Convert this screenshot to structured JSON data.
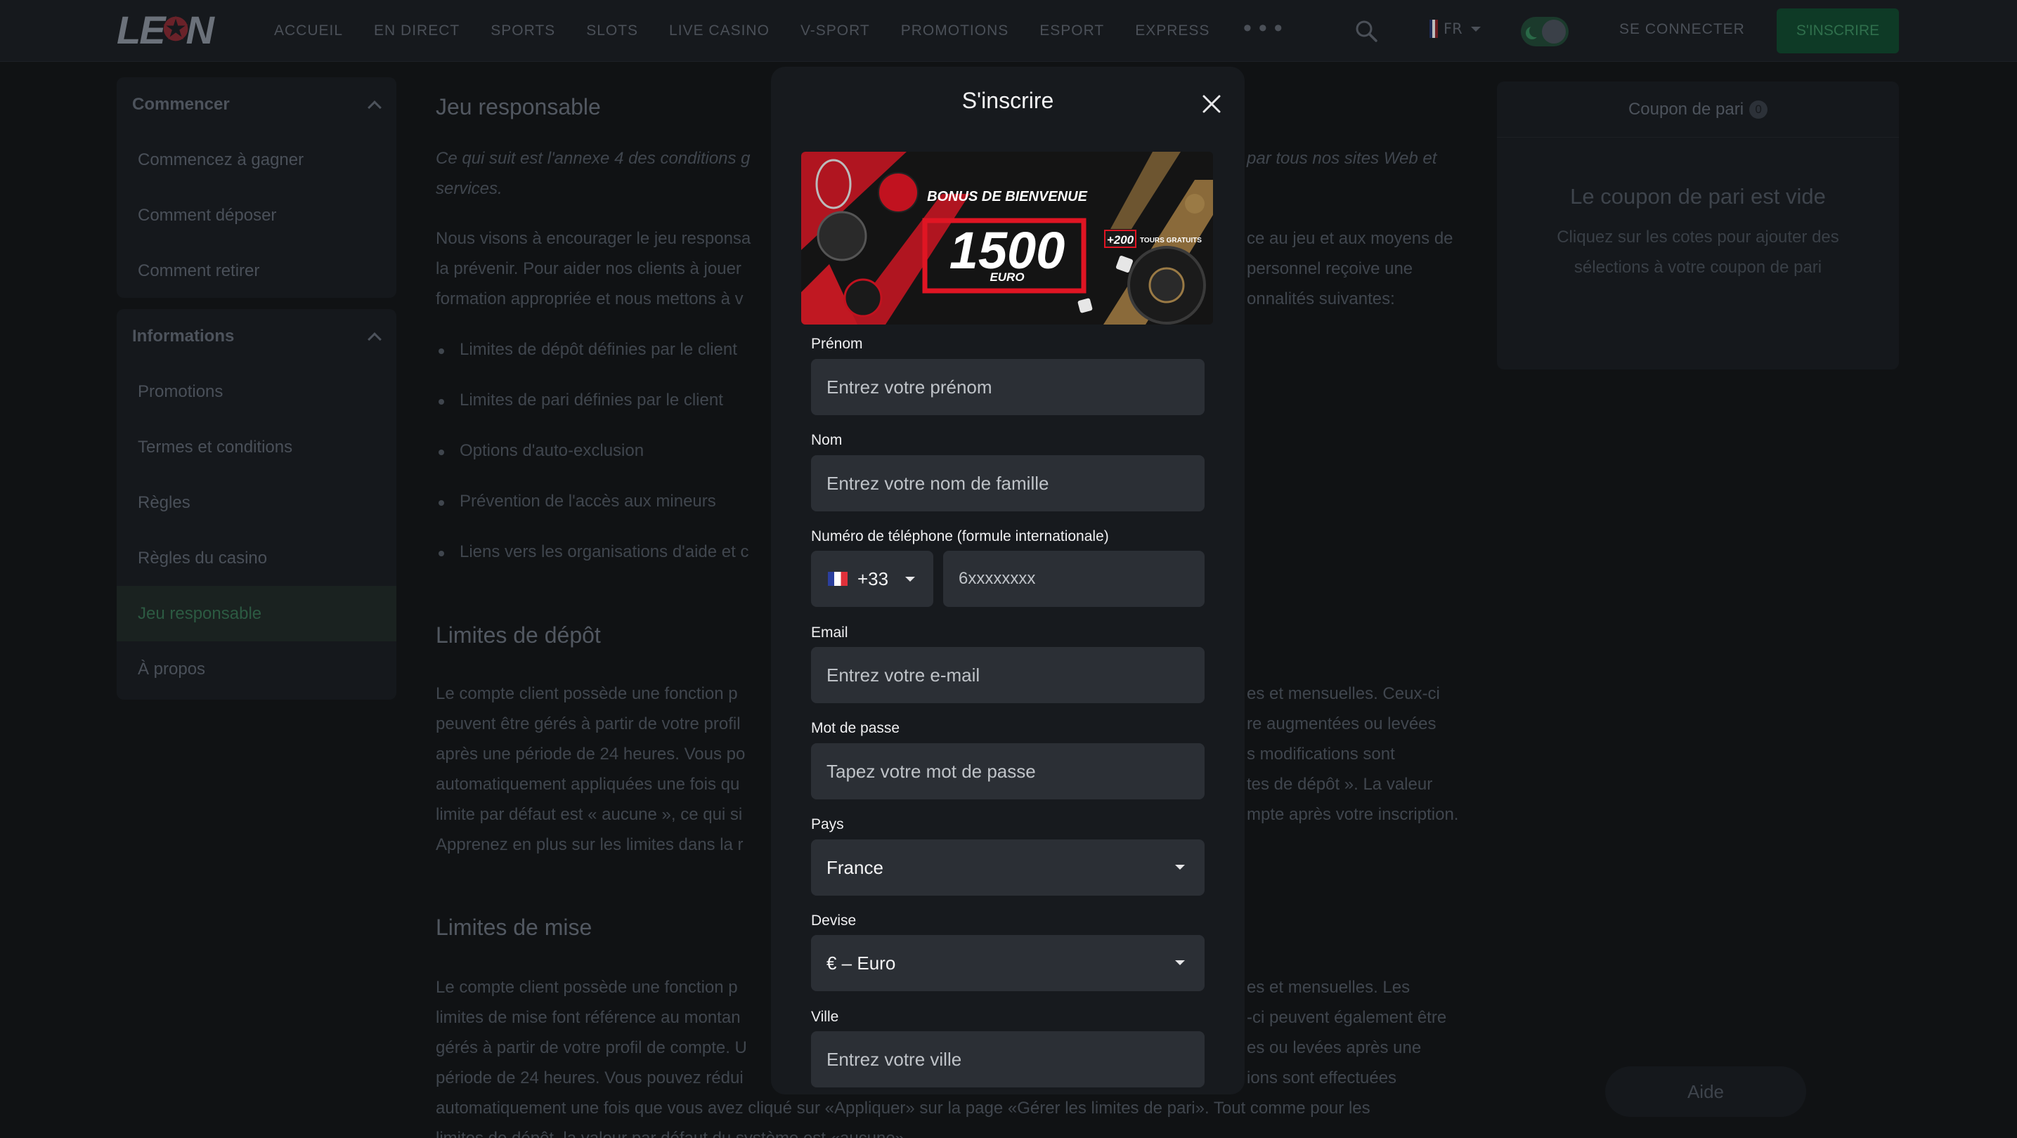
{
  "header": {
    "logo_text": "LE",
    "logo_text_end": "N",
    "nav": [
      "ACCUEIL",
      "EN DIRECT",
      "SPORTS",
      "SLOTS",
      "LIVE CASINO",
      "V-SPORT",
      "PROMOTIONS",
      "ESPORT",
      "EXPRESS"
    ],
    "more": "•••",
    "lang": "FR",
    "login": "SE CONNECTER",
    "signup": "S'INSCRIRE"
  },
  "sidebar": {
    "sections": [
      {
        "title": "Commencer",
        "items": [
          "Commencez à gagner",
          "Comment déposer",
          "Comment retirer"
        ]
      },
      {
        "title": "Informations",
        "items": [
          "Promotions",
          "Termes et conditions",
          "Règles",
          "Règles du casino",
          "Jeu responsable",
          "À propos"
        ]
      }
    ]
  },
  "article": {
    "h1": "Jeu responsable",
    "intro_a": "Ce qui suit est l'annexe 4 des conditions g",
    "intro_b": "par tous nos sites Web et",
    "intro_c": "services.",
    "p1_lines": [
      [
        "Nous visons à encourager le jeu responsa",
        "ce au jeu et aux moyens de"
      ],
      [
        "la prévenir. Pour aider nos clients à jouer",
        "personnel reçoive une"
      ],
      [
        "formation appropriée et nous mettons à v",
        "onnalités suivantes:"
      ]
    ],
    "bullets": [
      "Limites de dépôt définies par le client",
      "Limites de pari définies par le client",
      "Options d'auto-exclusion",
      "Prévention de l'accès aux mineurs",
      "Liens vers les organisations d'aide et c"
    ],
    "h2": "Limites de dépôt",
    "p2_lines": [
      [
        "Le compte client possède une fonction p",
        "es et mensuelles. Ceux-ci"
      ],
      [
        "peuvent être gérés à partir de votre profil",
        "re augmentées ou levées"
      ],
      [
        "après une période de 24 heures. Vous po",
        "s modifications sont"
      ],
      [
        "automatiquement appliquées une fois qu",
        "tes de dépôt ». La valeur"
      ],
      [
        "limite par défaut est « aucune », ce qui si",
        "mpte après votre inscription."
      ],
      [
        "Apprenez en plus sur les limites dans la r",
        ""
      ]
    ],
    "h3": "Limites de mise",
    "p3_lines": [
      [
        "Le compte client possède une fonction p",
        "es et mensuelles. Les"
      ],
      [
        "limites de mise font référence au montan",
        "-ci peuvent également être"
      ],
      [
        "gérés à partir de votre profil de compte. U",
        "es ou levées après une"
      ],
      [
        "période de 24 heures. Vous pouvez rédui",
        "ions sont effectuées"
      ],
      [
        "automatiquement une fois que vous avez cliqué sur «Appliquer» sur la page «Gérer les limites de pari». Tout comme pour les",
        ""
      ],
      [
        "limites de dépôt, la valeur par défaut du système est «aucune».",
        ""
      ]
    ]
  },
  "coupon": {
    "title": "Coupon de pari",
    "count": "0",
    "empty_title": "Le coupon de pari est vide",
    "empty_text": "Cliquez sur les cotes pour ajouter des sélections à votre coupon de pari"
  },
  "help": "Aide",
  "modal": {
    "title": "S'inscrire",
    "banner": {
      "headline": "BONUS DE BIENVENUE",
      "amount": "1500",
      "currency": "EURO",
      "extra": "+200",
      "extra_label": "TOURS GRATUITS"
    },
    "fields": {
      "first_name": {
        "label": "Prénom",
        "placeholder": "Entrez votre prénom"
      },
      "last_name": {
        "label": "Nom",
        "placeholder": "Entrez votre nom de famille"
      },
      "phone": {
        "label": "Numéro de téléphone (formule internationale)",
        "code": "+33",
        "placeholder": "6xxxxxxxx"
      },
      "email": {
        "label": "Email",
        "placeholder": "Entrez votre e-mail"
      },
      "password": {
        "label": "Mot de passe",
        "placeholder": "Tapez votre mot de passe"
      },
      "country": {
        "label": "Pays",
        "value": "France"
      },
      "currency": {
        "label": "Devise",
        "value": "€ – Euro"
      },
      "city": {
        "label": "Ville",
        "placeholder": "Entrez votre ville"
      }
    }
  }
}
